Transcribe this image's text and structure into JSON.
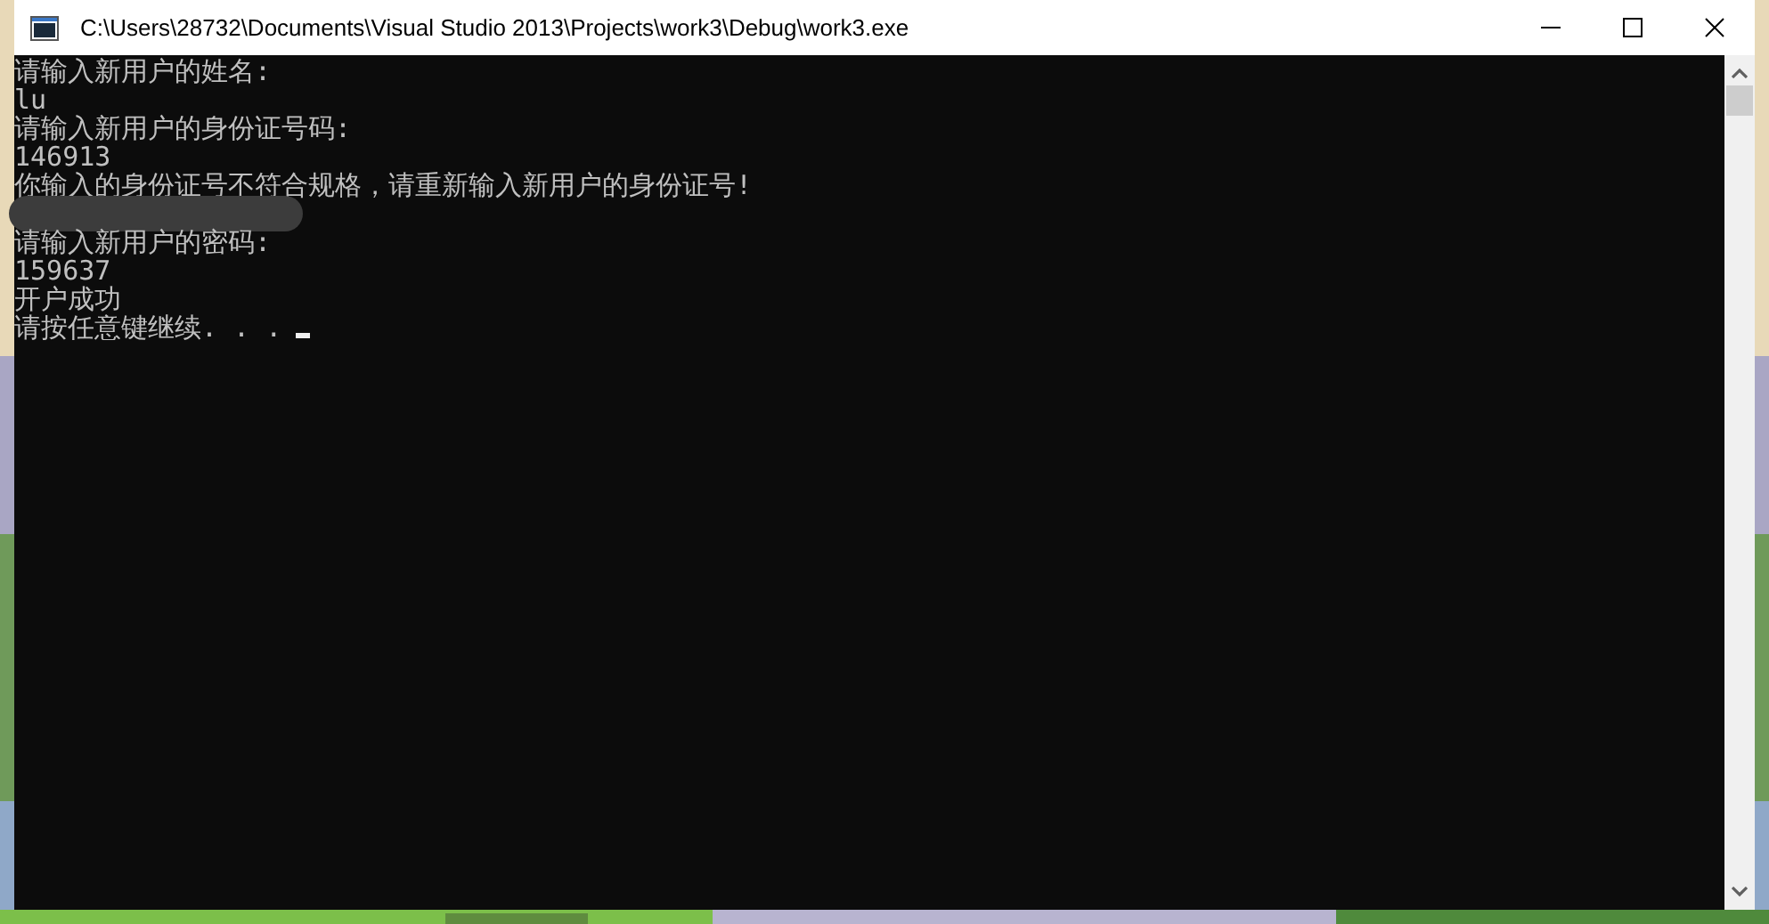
{
  "window": {
    "title": "C:\\Users\\28732\\Documents\\Visual Studio 2013\\Projects\\work3\\Debug\\work3.exe"
  },
  "console": {
    "lines": [
      {
        "kind": "text",
        "text": "请输入新用户的姓名:"
      },
      {
        "kind": "text",
        "text": "lu"
      },
      {
        "kind": "text",
        "text": "请输入新用户的身份证号码:"
      },
      {
        "kind": "text",
        "text": "146913"
      },
      {
        "kind": "text",
        "text": "你输入的身份证号不符合规格，请重新输入新用户的身份证号!"
      },
      {
        "kind": "redacted"
      },
      {
        "kind": "text",
        "text": "请输入新用户的密码:"
      },
      {
        "kind": "text",
        "text": "159637"
      },
      {
        "kind": "text",
        "text": "开户成功"
      },
      {
        "kind": "prompt",
        "text": "请按任意键继续. . ."
      }
    ]
  }
}
